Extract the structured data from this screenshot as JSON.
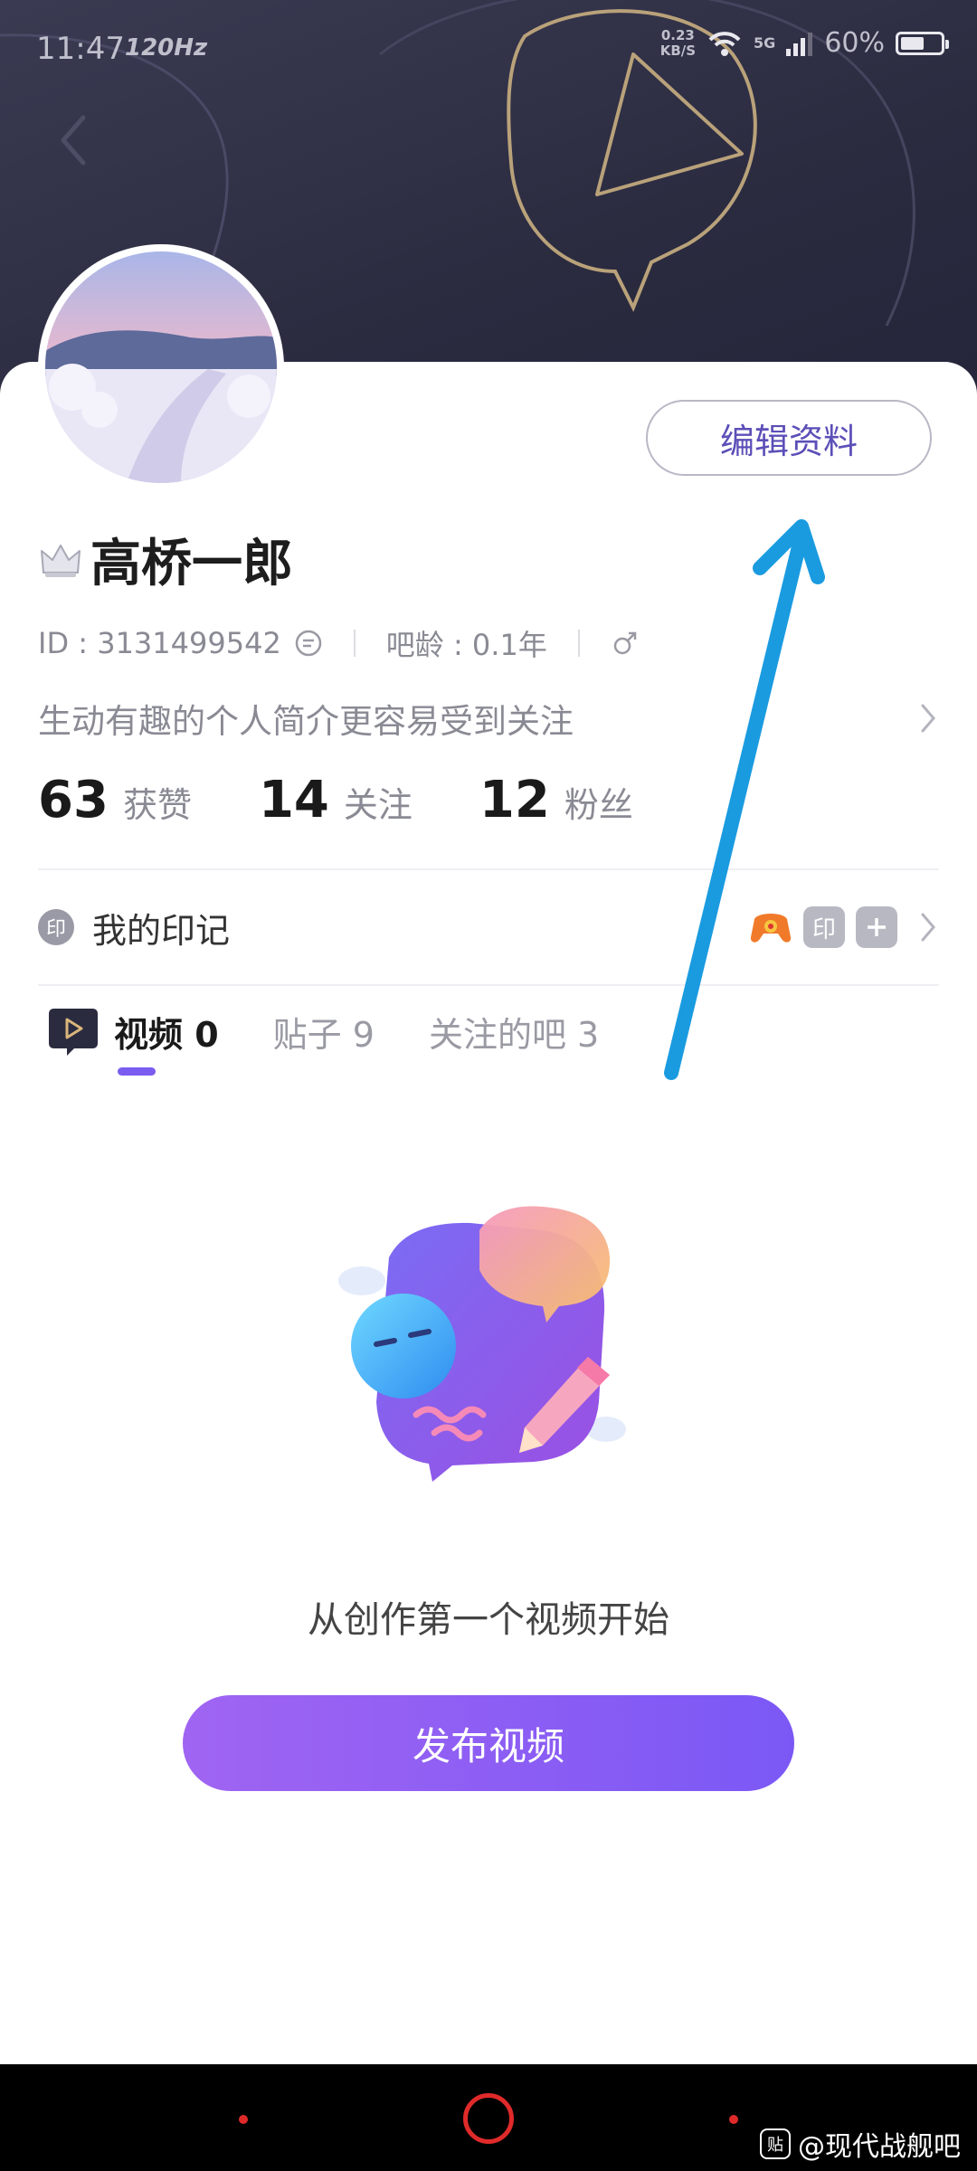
{
  "status_bar": {
    "time": "11:47",
    "refresh_rate": "120Hz",
    "net_speed_value": "0.23",
    "net_speed_unit": "KB/S",
    "network": "5G",
    "battery": "60%",
    "battery_level": 0.6
  },
  "profile": {
    "username": "高桥一郎",
    "edit_label": "编辑资料",
    "id_text": "ID : 3131499542",
    "age_text": "吧龄 : 0.1年",
    "bio_placeholder": "生动有趣的个人简介更容易受到关注"
  },
  "stats": [
    {
      "value": "63",
      "label": "获赞"
    },
    {
      "value": "14",
      "label": "关注"
    },
    {
      "value": "12",
      "label": "粉丝"
    }
  ],
  "marks": {
    "label": "我的印记",
    "icon_text": "印",
    "badge_text": "印"
  },
  "tabs": [
    {
      "label": "视频 0",
      "active": true
    },
    {
      "label": "贴子 9",
      "active": false
    },
    {
      "label": "关注的吧 3",
      "active": false
    }
  ],
  "empty_state": {
    "message": "从创作第一个视频开始",
    "button_label": "发布视频"
  },
  "watermark": {
    "icon_text": "贴",
    "text": "@现代战舰吧"
  },
  "colors": {
    "accent": "#7a5cf0",
    "header_bg": "#2b2b40",
    "annotation_arrow": "#1a9be0"
  }
}
